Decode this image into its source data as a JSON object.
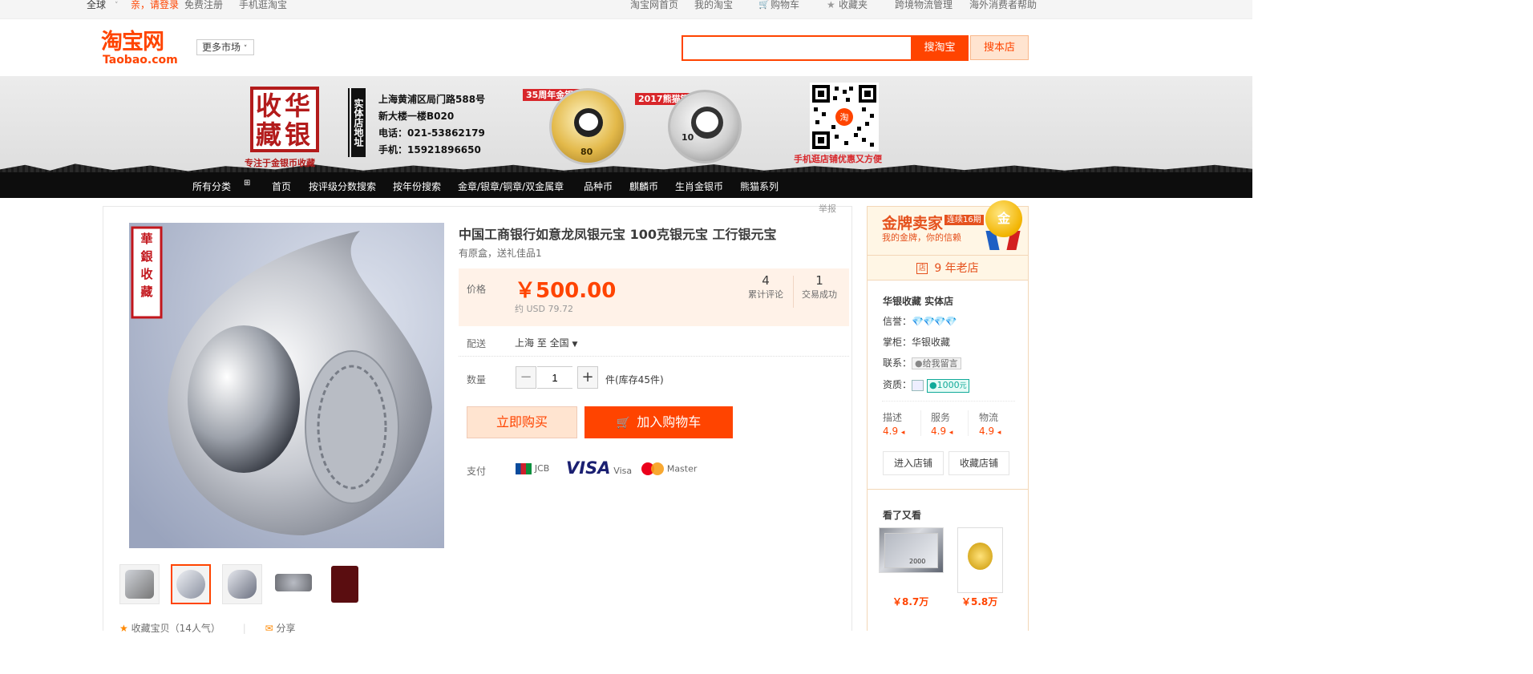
{
  "topbar": {
    "region": "全球",
    "login": "亲，请登录",
    "register": "免费注册",
    "mobile": "手机逛淘宝",
    "home": "淘宝网首页",
    "my_taobao": "我的淘宝",
    "cart": "购物车",
    "favorites": "收藏夹",
    "logistics": "跨境物流管理",
    "help": "海外消费者帮助"
  },
  "header": {
    "logo_cn": "淘宝网",
    "logo_en": "Taobao.com",
    "more_market": "更多市场",
    "search_value": "",
    "search_btn": "搜淘宝",
    "search_shop_btn": "搜本店"
  },
  "banner": {
    "stamp_text": "收华藏银",
    "stamp_sub": "专注于金银币收藏",
    "store_tag": "实体店地址",
    "addr1": "上海黄浦区局门路588号",
    "addr2": "新大楼一楼B020",
    "phone": "电话：021-53862179",
    "mobile": "手机：15921896650",
    "coin1_label": "35周年金银币",
    "coin2_label": "2017熊猫银币",
    "coin1_value": "80",
    "coin2_value": "10",
    "qr_text": "手机逛店铺优惠又方便"
  },
  "nav": {
    "items": [
      "所有分类",
      "首页",
      "按评级分数搜索",
      "按年份搜索",
      "金章/银章/铜章/双金属章",
      "品种币",
      "麒麟币",
      "生肖金银币",
      "熊猫系列"
    ]
  },
  "product": {
    "report": "举报",
    "title": "中国工商银行如意龙凤银元宝 100克银元宝 工行银元宝",
    "subtitle": "有原盒，送礼佳品1",
    "price_label": "价格",
    "price": "￥500.00",
    "usd": "约 USD 79.72",
    "reviews_count": "4",
    "reviews_label": "累计评论",
    "deals_count": "1",
    "deals_label": "交易成功",
    "ship_label": "配送",
    "ship_value": "上海 至  全国",
    "qty_label": "数量",
    "qty_value": "1",
    "stock": "件(库存45件)",
    "buy_now": "立即购买",
    "add_cart": "加入购物车",
    "pay_label": "支付",
    "pay_methods": [
      "JCB",
      "VISA",
      "Visa",
      "Master"
    ],
    "image_stamp": "華銀收藏",
    "fav_text": "收藏宝贝（14人气）",
    "share_text": "分享"
  },
  "seller": {
    "gold_title": "金牌卖家",
    "gold_badge": "连续16期",
    "gold_slogan": "我的金牌，你的信赖",
    "medal_text": "金",
    "years": "9 年老店",
    "shop_name": "华银收藏 实体店",
    "credit_label": "信誉：",
    "keeper_label": "掌柜：",
    "keeper": "华银收藏",
    "contact_label": "联系：",
    "contact": "给我留言",
    "qual_label": "资质：",
    "deposit": "1000",
    "deposit_unit": "元",
    "scores": [
      {
        "label": "描述",
        "value": "4.9"
      },
      {
        "label": "服务",
        "value": "4.9"
      },
      {
        "label": "物流",
        "value": "4.9"
      }
    ],
    "enter_shop": "进入店铺",
    "fav_shop": "收藏店铺",
    "also_viewed": "看了又看",
    "also_items": [
      {
        "price": "￥8.7万",
        "img_text": "2000"
      },
      {
        "price": "￥5.8万"
      }
    ]
  },
  "colors": {
    "accent": "#ff4400",
    "gold": "#e5511d",
    "nav_bg": "#0d0d0d"
  }
}
